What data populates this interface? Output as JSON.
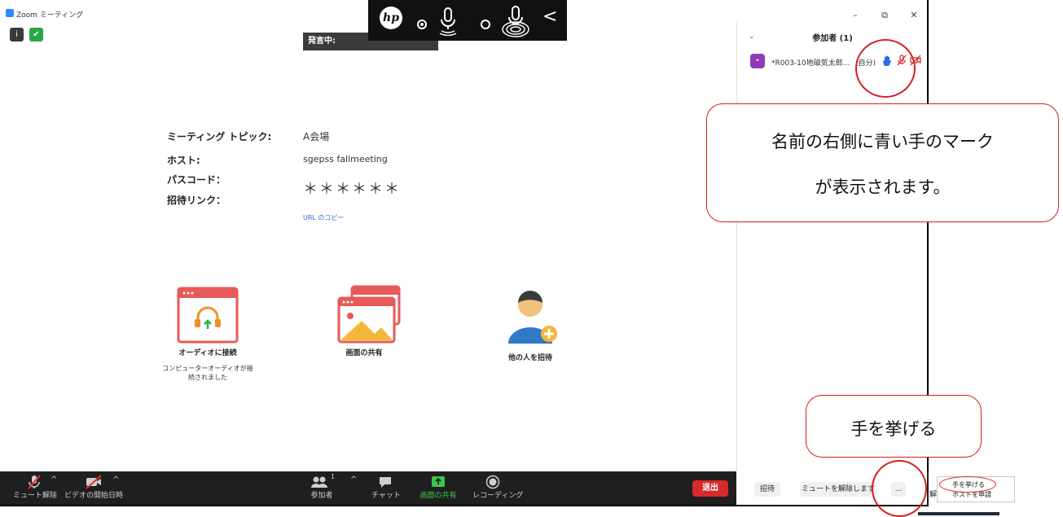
{
  "window": {
    "title": "Zoom ミーティング",
    "controls": {
      "minimize": "–",
      "restore": "⧉",
      "close": "✕"
    }
  },
  "hp_toolbar": {
    "logo": "hp",
    "back": "<"
  },
  "speaker": {
    "label": "発言中:"
  },
  "meeting_info": {
    "topic_label": "ミーティング トピック:",
    "topic_value": "A会場",
    "host_label": "ホスト:",
    "host_value": "sgepss fallmeeting",
    "passcode_label": "パスコード：",
    "passcode_value": "＊＊＊＊＊＊",
    "invite_label": "招待リンク：",
    "copy_url": "URL のコピー"
  },
  "actions": {
    "audio": {
      "label": "オーディオに接続",
      "sub1": "コンピューターオーディオが接",
      "sub2": "続されました"
    },
    "share": {
      "label": "画面の共有"
    },
    "invite": {
      "label": "他の人を招待"
    }
  },
  "toolbar": {
    "unmute": "ミュート解除",
    "start_video": "ビデオの開始日時",
    "participants": "参加者",
    "participants_count": "1",
    "chat": "チャット",
    "share_screen": "画面の共有",
    "recording": "レコーディング",
    "leave": "退出",
    "caret": "^"
  },
  "participants_panel": {
    "header": "参加者 (1)",
    "collapse": "⌄",
    "avatar_initial": "•",
    "name": "*R003-10地磁気太郎...",
    "self_tag": "(自分)",
    "footer_invite": "招待",
    "footer_unmute": "ミュートを解除します",
    "footer_more": "..."
  },
  "raise_menu": {
    "item1": "手を挙げる",
    "item2": "ホストを申請",
    "cut_text": "解"
  },
  "callouts": {
    "big_line1": "名前の右側に青い手のマーク",
    "big_line2": "が表示されます。",
    "small": "手を挙げる"
  },
  "colors": {
    "toolbar_bg": "#1f1f1f",
    "leave": "#d92b2b",
    "share_green": "#3cc74a",
    "annotation_red": "#d61f1f",
    "hand_blue": "#2d6cdf",
    "avatar_purple": "#8e3bb8"
  }
}
